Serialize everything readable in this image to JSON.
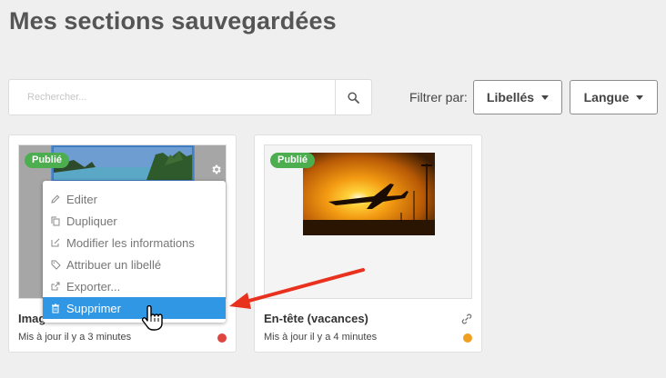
{
  "header": {
    "title": "Mes sections sauvegardées"
  },
  "search": {
    "placeholder": "Rechercher...",
    "icon": "search-icon"
  },
  "filters": {
    "label": "Filtrer par:",
    "labels_dropdown": "Libellés",
    "language_dropdown": "Langue"
  },
  "cards": [
    {
      "badge": "Publié",
      "name": "Image",
      "updated": "Mis à jour il y a 3 minutes",
      "status_color": "#e0443f"
    },
    {
      "badge": "Publié",
      "name": "En-tête (vacances)",
      "updated": "Mis à jour il y a 4 minutes",
      "status_color": "#f0a020"
    }
  ],
  "menu": {
    "items": [
      {
        "label": "Editer",
        "icon": "pencil-icon"
      },
      {
        "label": "Dupliquer",
        "icon": "copy-icon"
      },
      {
        "label": "Modifier les informations",
        "icon": "edit-info-icon"
      },
      {
        "label": "Attribuer un libellé",
        "icon": "tag-icon"
      },
      {
        "label": "Exporter...",
        "icon": "export-icon"
      },
      {
        "label": "Supprimer",
        "icon": "trash-icon"
      }
    ]
  },
  "colors": {
    "badge_green": "#4cae4f",
    "highlight_blue": "#2f97e3",
    "annotation_red": "#e8321e"
  }
}
